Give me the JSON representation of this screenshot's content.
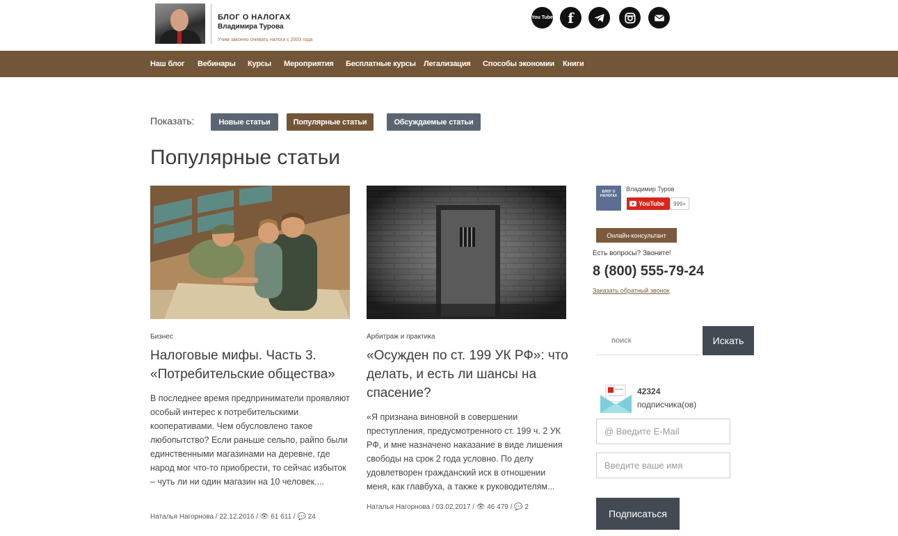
{
  "header": {
    "logo_title": "БЛОГ О НАЛОГАХ",
    "logo_subtitle": "Владимира Турова",
    "logo_tagline": "Учим законно снижать налоги с 2003 года",
    "social": [
      {
        "name": "youtube-icon",
        "label": "You Tube"
      },
      {
        "name": "facebook-icon",
        "label": "f"
      },
      {
        "name": "telegram-icon",
        "label": ""
      },
      {
        "name": "instagram-icon",
        "label": ""
      },
      {
        "name": "email-icon",
        "label": ""
      }
    ]
  },
  "nav": {
    "items": [
      "Наш блог",
      "Вебинары",
      "Курсы",
      "Мероприятия",
      "Бесплатные курсы",
      "Легализация",
      "Способы экономии",
      "Книги"
    ]
  },
  "filter": {
    "label": "Показать:",
    "buttons": [
      "Новые статьи",
      "Популярные статьи",
      "Обсуждаемые статьи"
    ],
    "active_index": 1,
    "colors": {
      "inactive": "#5a6571",
      "active": "#735537"
    }
  },
  "page_title": "Популярные статьи",
  "articles": [
    {
      "category": "Бизнес",
      "title": "Налоговые мифы. Часть 3. «Потребительские общества»",
      "excerpt": "В последнее время предприниматели проявляют особый интерес к потребительскими кооперативами. Чем обусловлено такое любопытство? Если раньше сельпо, райпо были единственными магазинами на деревне, где народ мог что-то приобрести, то сейчас избыток – чуть ли ни один магазин на 10 человек....",
      "author": "Наталья Нагорнова",
      "date": "22.12.2016",
      "views": "61 611",
      "comments": "24"
    },
    {
      "category": "Арбитраж и практика",
      "title": "«Осужден по ст. 199 УК РФ»: что делать, и есть ли шансы на спасение?",
      "excerpt": "«Я признана виновной в совершении преступления, предусмотренного ст. 199 ч. 2 УК РФ, и мне назначено наказание в виде лишения свободы на срок 2 года условно. По делу удовлетворен гражданский иск в отношении меня, как главбуха, а также к руководителям...",
      "author": "Наталья Нагорнова",
      "date": "03.02.2017",
      "views": "46 479",
      "comments": "2"
    }
  ],
  "sidebar": {
    "youtube": {
      "logo_text": "БЛОГ О НАЛОГАХ",
      "channel_name": "Владимир Туров",
      "button_label": "YouTube",
      "count": "999+"
    },
    "consultant_label": "Онлайн-консультант",
    "questions": "Есть вопросы? Звоните!",
    "phone": "8 (800) 555-79-24",
    "callback": "Заказать обратный звонок",
    "search": {
      "placeholder": "поиск",
      "button": "Искать"
    },
    "subscribe": {
      "count": "42324",
      "label": "подписчика(ов)",
      "email_placeholder": "@ Введите E-Mail",
      "name_placeholder": "Введите ваше имя",
      "button": "Подписаться"
    }
  }
}
